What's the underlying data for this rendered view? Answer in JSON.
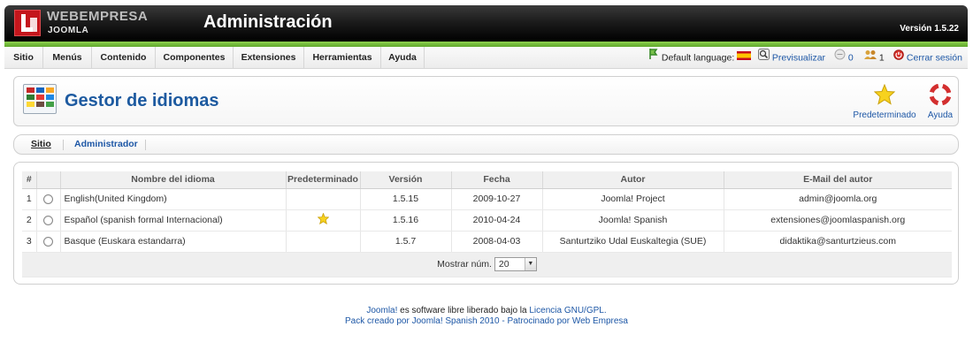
{
  "header": {
    "brand_top": "WEBEMPRESA",
    "brand_bottom": "JOOMLA",
    "title": "Administración",
    "version": "Versión 1.5.22"
  },
  "menu": {
    "items": [
      "Sitio",
      "Menús",
      "Contenido",
      "Componentes",
      "Extensiones",
      "Herramientas",
      "Ayuda"
    ]
  },
  "status": {
    "default_language_label": "Default language:",
    "preview": "Previsualizar",
    "messages_count": "0",
    "users_count": "1",
    "logout": "Cerrar sesión"
  },
  "toolbar": {
    "title": "Gestor de idiomas",
    "default_btn": "Predeterminado",
    "help_btn": "Ayuda"
  },
  "submenu": {
    "site": "Sitio",
    "admin": "Administrador"
  },
  "table": {
    "headers": {
      "num": "#",
      "name": "Nombre del idioma",
      "default": "Predeterminado",
      "version": "Versión",
      "date": "Fecha",
      "author": "Autor",
      "email": "E-Mail del autor"
    },
    "rows": [
      {
        "num": "1",
        "name": "English(United Kingdom)",
        "version": "1.5.15",
        "date": "2009-10-27",
        "author": "Joomla! Project",
        "email": "admin@joomla.org"
      },
      {
        "num": "2",
        "name": "Español (spanish formal Internacional)",
        "version": "1.5.16",
        "date": "2010-04-24",
        "author": "Joomla! Spanish",
        "email": "extensiones@joomlaspanish.org"
      },
      {
        "num": "3",
        "name": "Basque (Euskara estandarra)",
        "version": "1.5.7",
        "date": "2008-04-03",
        "author": "Santurtziko Udal Euskaltegia (SUE)",
        "email": "didaktika@santurtzieus.com"
      }
    ],
    "show_label": "Mostrar núm.",
    "show_value": "20"
  },
  "footer": {
    "line1_link1": "Joomla!",
    "line1_text": " es software libre liberado bajo la ",
    "line1_link2": "Licencia GNU/GPL.",
    "line2": "Pack creado por Joomla! Spanish 2010 - Patrocinado por Web Empresa"
  },
  "colors": {
    "accent_green": "#5ea72a",
    "title_blue": "#1d5aa0",
    "link_blue": "#1d57a6"
  }
}
